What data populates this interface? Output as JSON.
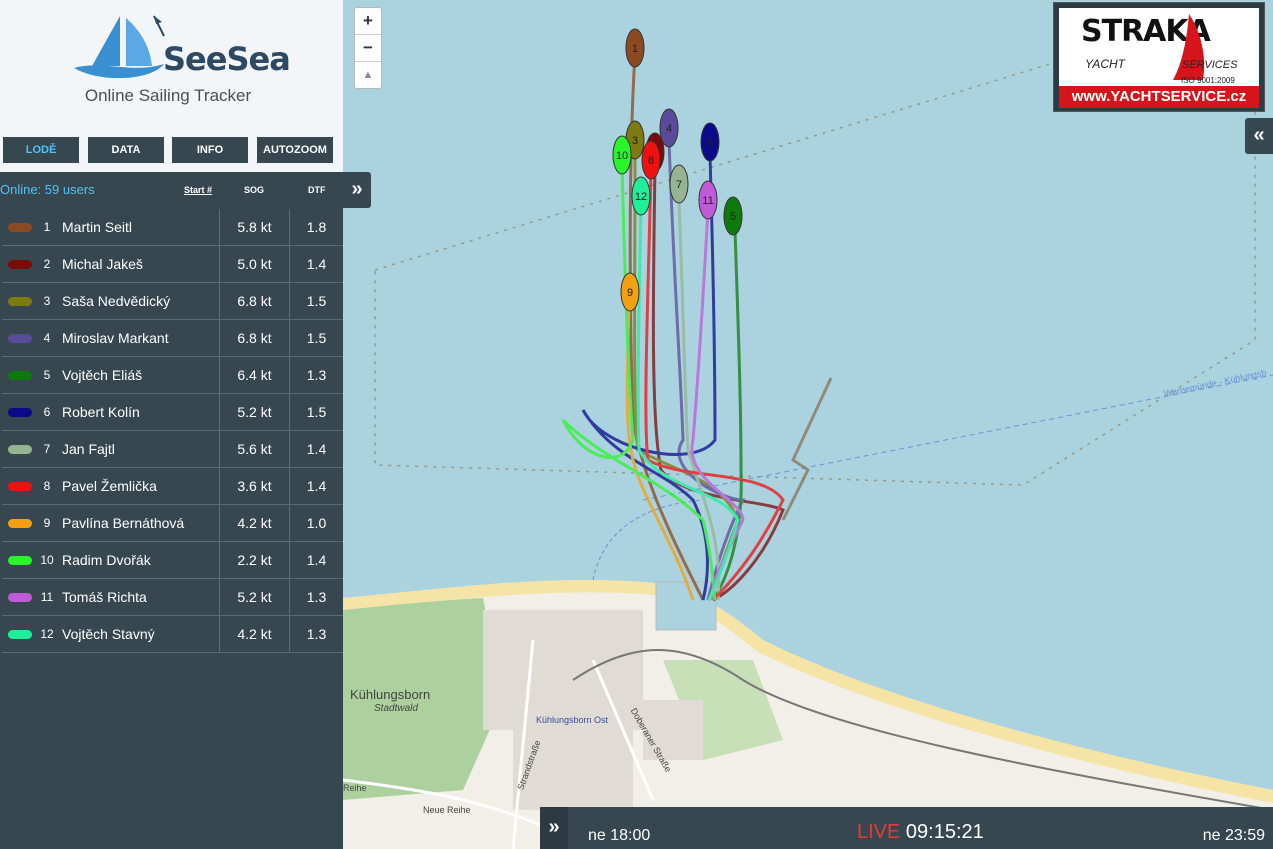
{
  "app": {
    "name": "SeeSea",
    "subtitle": "Online Sailing Tracker"
  },
  "nav": [
    {
      "label": "LODĚ",
      "active": true
    },
    {
      "label": "DATA",
      "active": false
    },
    {
      "label": "INFO",
      "active": false
    },
    {
      "label": "AUTOZOOM",
      "active": false
    }
  ],
  "table": {
    "online": "Online: 59 users",
    "start_header": "Start #",
    "sog_header": "SOG",
    "dtf_header": "DTF",
    "collapse_icon": "»"
  },
  "boats": [
    {
      "num": "1",
      "name": "Martin Seitl",
      "sog": "5.8 kt",
      "dtf": "1.8",
      "color": "#8b4a1f"
    },
    {
      "num": "2",
      "name": "Michal Jakeš",
      "sog": "5.0 kt",
      "dtf": "1.4",
      "color": "#7a0b0b"
    },
    {
      "num": "3",
      "name": "Saša Nedvědický",
      "sog": "6.8 kt",
      "dtf": "1.5",
      "color": "#7d7a10"
    },
    {
      "num": "4",
      "name": "Miroslav Markant",
      "sog": "6.8 kt",
      "dtf": "1.5",
      "color": "#5a4a9a"
    },
    {
      "num": "5",
      "name": "Vojtěch Eliáš",
      "sog": "6.4 kt",
      "dtf": "1.3",
      "color": "#0e7a0e"
    },
    {
      "num": "6",
      "name": "Robert Kolín",
      "sog": "5.2 kt",
      "dtf": "1.5",
      "color": "#0a0a8a"
    },
    {
      "num": "7",
      "name": "Jan Fajtl",
      "sog": "5.6 kt",
      "dtf": "1.4",
      "color": "#94b590"
    },
    {
      "num": "8",
      "name": "Pavel Žemlička",
      "sog": "3.6 kt",
      "dtf": "1.4",
      "color": "#f01010"
    },
    {
      "num": "9",
      "name": "Pavlína Bernáthová",
      "sog": "4.2 kt",
      "dtf": "1.0",
      "color": "#f5a010"
    },
    {
      "num": "10",
      "name": "Radim Dvořák",
      "sog": "2.2 kt",
      "dtf": "1.4",
      "color": "#2af52a"
    },
    {
      "num": "11",
      "name": "Tomáš Richta",
      "sog": "5.2 kt",
      "dtf": "1.3",
      "color": "#c05ad8"
    },
    {
      "num": "12",
      "name": "Vojtěch Stavný",
      "sog": "4.2 kt",
      "dtf": "1.3",
      "color": "#1ef09a"
    }
  ],
  "map": {
    "zoom_in": "+",
    "zoom_out": "−",
    "compass": "▲",
    "right_toggle": "«",
    "labels": {
      "town": "Kühlungsborn",
      "district": "Stadtwald",
      "station": "Kühlungsborn Ost",
      "route": "Warnemünde - Kühlungsb",
      "street1": "Neue Reihe",
      "street2": "Strandstraße",
      "street3": "Doberaner Straße",
      "street4": "Reihe"
    },
    "sponsor": {
      "name": "STRAKA",
      "yacht": "YACHT",
      "services": "SERVICES",
      "iso": "ISO 9001:2009",
      "url": "www.YACHTSERVICE.cz"
    }
  },
  "timeline": {
    "toggle": "»",
    "start": "ne 18:00",
    "live": "LIVE",
    "time": "09:15:21",
    "end": "ne 23:59"
  },
  "colors": {
    "sidebar": "#37474f",
    "water": "#aad3df",
    "land": "#f2efe9",
    "accent": "#4fc3f7",
    "live": "#e53935"
  }
}
